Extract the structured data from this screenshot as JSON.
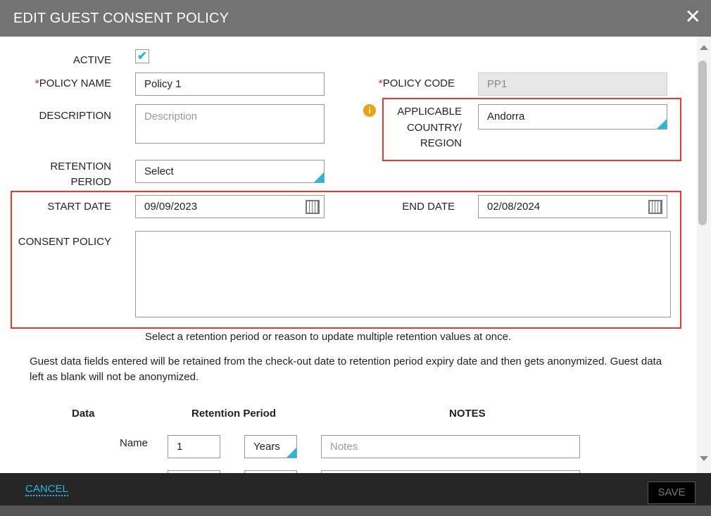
{
  "dialog": {
    "title": "EDIT GUEST CONSENT POLICY"
  },
  "form": {
    "active_label": "ACTIVE",
    "active_checked": true,
    "policy_name_label": "POLICY NAME",
    "policy_name_value": "Policy 1",
    "policy_code_label": "POLICY CODE",
    "policy_code_value": "PP1",
    "required_mark": "*",
    "description_label": "DESCRIPTION",
    "description_placeholder": "Description",
    "country_label": "APPLICABLE COUNTRY/ REGION",
    "country_value": "Andorra",
    "retention_label": "RETENTION PERIOD",
    "retention_value": "Select",
    "start_date_label": "START DATE",
    "start_date_value": "09/09/2023",
    "end_date_label": "END DATE",
    "end_date_value": "02/08/2024",
    "consent_label": "CONSENT POLICY",
    "consent_value": ""
  },
  "info": {
    "hint": "Select a retention period or reason to update multiple retention values at once.",
    "paragraph": "Guest data fields entered will be retained from the check-out date to retention period expiry date and then gets anonymized. Guest data left as blank will not be anonymized."
  },
  "table": {
    "headers": [
      "Data",
      "Retention Period",
      "NOTES"
    ],
    "rows": [
      {
        "label": "Name",
        "value": "1",
        "unit": "Years",
        "notes_placeholder": "Notes"
      }
    ]
  },
  "footer": {
    "cancel": "CANCEL",
    "save": "SAVE"
  },
  "colors": {
    "accent": "#29b6e0",
    "highlight": "#e53935",
    "header": "#737373",
    "footer": "#262626",
    "info": "#e8a317"
  }
}
